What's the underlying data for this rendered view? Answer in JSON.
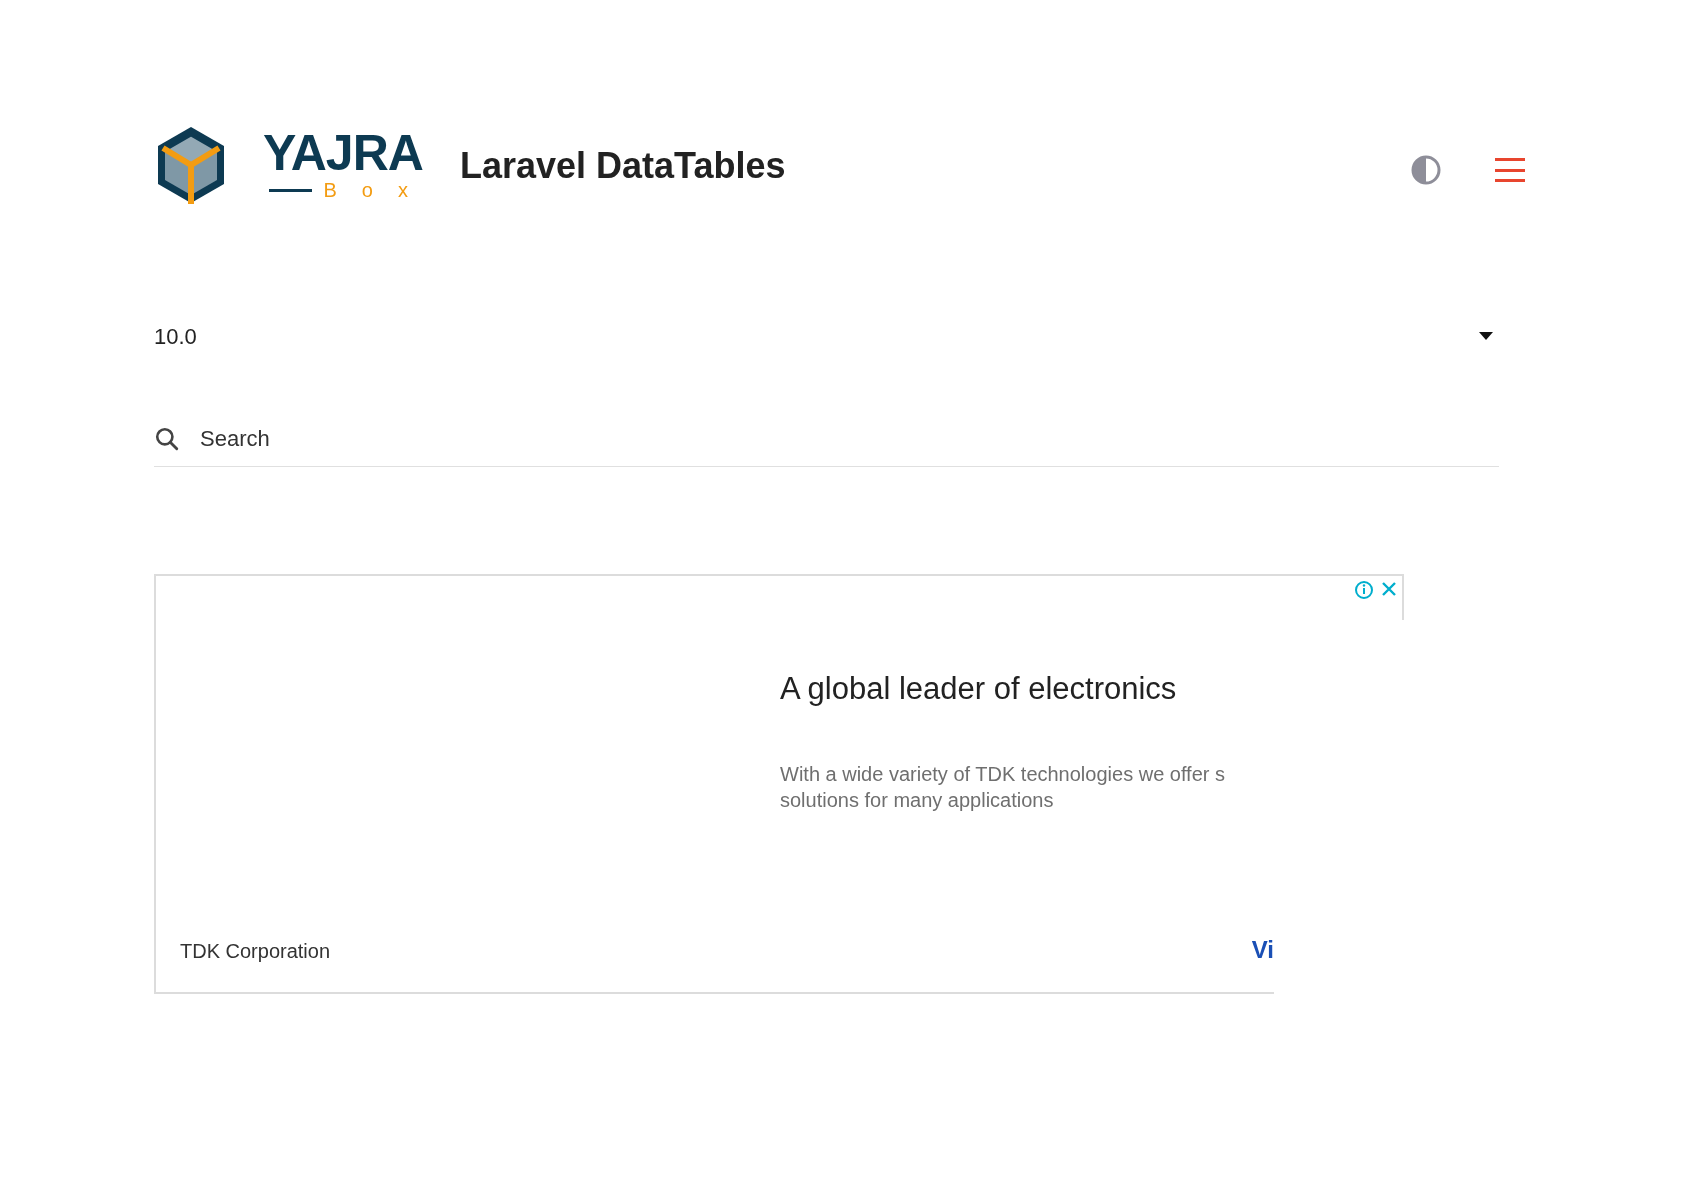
{
  "header": {
    "logo_name": "YAJRA",
    "logo_sub": "Box",
    "title": "Laravel DataTables"
  },
  "version_select": {
    "value": "10.0"
  },
  "search": {
    "placeholder": "Search"
  },
  "ad": {
    "headline": "A global leader of electronics",
    "description_lines": [
      "With a wide variety of TDK technologies we offer s",
      "solutions for many applications"
    ],
    "advertiser": "TDK Corporation",
    "cta": "Vi"
  }
}
